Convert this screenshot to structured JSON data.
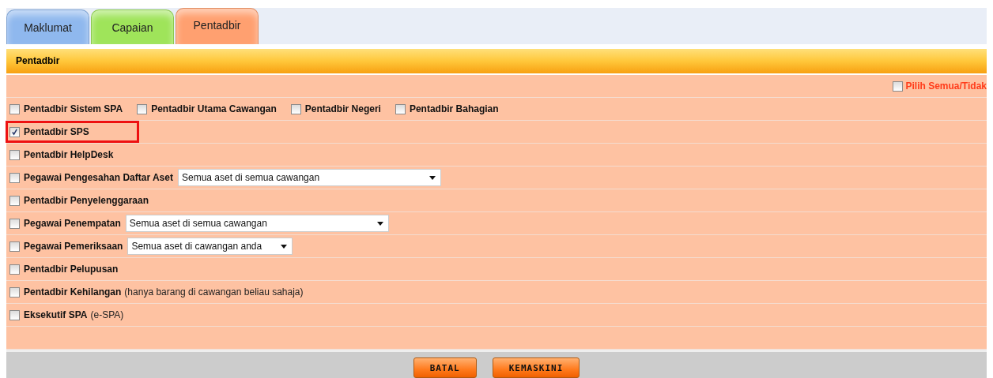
{
  "tabs": [
    {
      "label": "Maklumat",
      "selected": false,
      "color": "#8fb8ee"
    },
    {
      "label": "Capaian",
      "selected": false,
      "color": "#9fe45a"
    },
    {
      "label": "Pentadbir",
      "selected": true,
      "color": "#ffa070"
    }
  ],
  "panel": {
    "title": "Pentadbir",
    "select_all": {
      "label": "Pilih Semua/Tidak",
      "checked": false
    },
    "rows": [
      {
        "kind": "group",
        "items": [
          {
            "label": "Pentadbir Sistem SPA",
            "checked": false
          },
          {
            "label": "Pentadbir Utama Cawangan",
            "checked": false
          },
          {
            "label": "Pentadbir Negeri",
            "checked": false
          },
          {
            "label": "Pentadbir Bahagian",
            "checked": false
          }
        ]
      },
      {
        "kind": "single",
        "label": "Pentadbir SPS",
        "checked": true,
        "highlighted": true
      },
      {
        "kind": "single",
        "label": "Pentadbir HelpDesk",
        "checked": false,
        "highlighted": false
      },
      {
        "kind": "single",
        "label": "Pegawai Pengesahan Daftar Aset",
        "checked": false,
        "highlighted": false,
        "select": "Semua aset di semua cawangan"
      },
      {
        "kind": "single",
        "label": "Pentadbir Penyelenggaraan",
        "checked": false,
        "highlighted": false
      },
      {
        "kind": "single",
        "label": "Pegawai Penempatan",
        "checked": false,
        "highlighted": false,
        "select": "Semua aset di semua cawangan"
      },
      {
        "kind": "single",
        "label": "Pegawai Pemeriksaan",
        "checked": false,
        "highlighted": false,
        "select": "Semua aset di cawangan anda"
      },
      {
        "kind": "single",
        "label": "Pentadbir Pelupusan",
        "checked": false,
        "highlighted": false
      },
      {
        "kind": "single",
        "label": "Pentadbir Kehilangan",
        "checked": false,
        "highlighted": false,
        "note": "(hanya barang di cawangan beliau sahaja)"
      },
      {
        "kind": "single",
        "label": "Eksekutif SPA",
        "checked": false,
        "highlighted": false,
        "note": "(e-SPA)"
      }
    ]
  },
  "buttons": [
    "BATAL",
    "KEMASKINI"
  ]
}
